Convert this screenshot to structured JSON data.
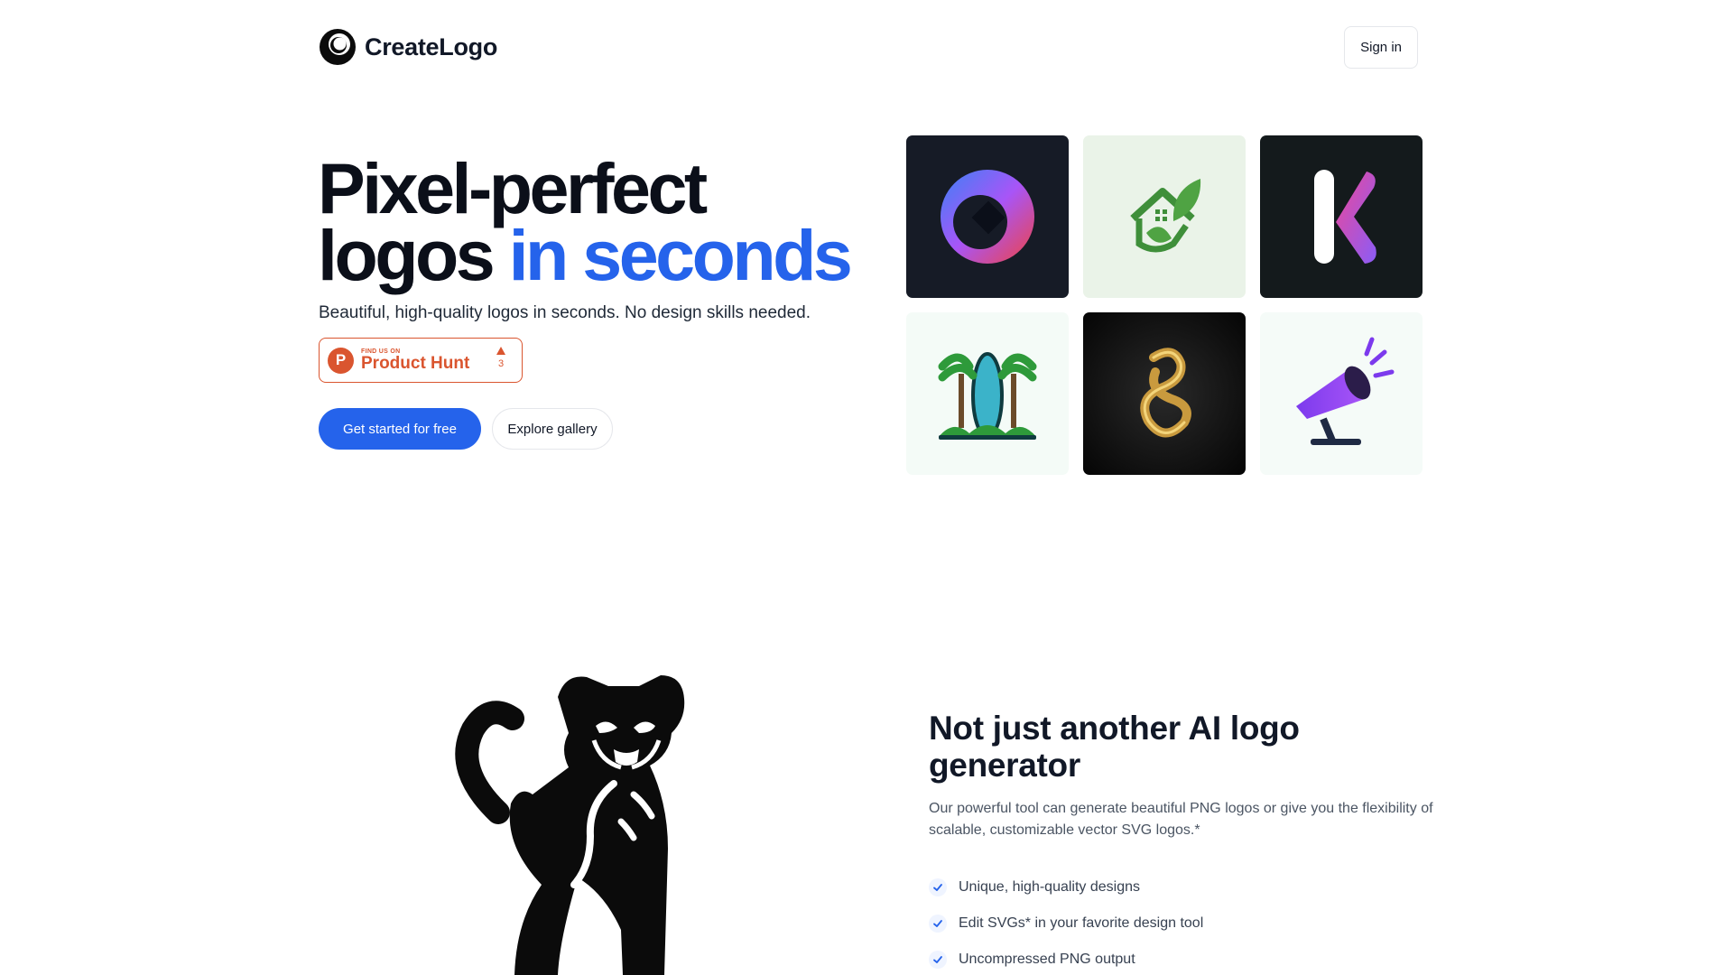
{
  "header": {
    "brand_name": "CreateLogo",
    "signin_label": "Sign in"
  },
  "hero": {
    "title_line1": "Pixel-perfect",
    "title_line2_plain": "logos ",
    "title_line2_accent": "in seconds",
    "subtitle": "Beautiful, high-quality logos in seconds. No design skills needed.",
    "product_hunt": {
      "small_text": "FIND US ON",
      "big_text": "Product Hunt",
      "vote_count": "3",
      "letter": "P"
    },
    "cta_primary": "Get started for free",
    "cta_secondary": "Explore gallery"
  },
  "gallery": {
    "tiles": [
      {
        "name": "orbit-logo"
      },
      {
        "name": "leaf-house-logo"
      },
      {
        "name": "letter-k-logo"
      },
      {
        "name": "palm-surfboard-logo"
      },
      {
        "name": "gold-snake-logo"
      },
      {
        "name": "megaphone-logo"
      }
    ]
  },
  "features": {
    "title": "Not just another AI logo generator",
    "description": "Our powerful tool can generate beautiful PNG logos or give you the flexibility of scalable, customizable vector SVG logos.*",
    "items": [
      "Unique, high-quality designs",
      "Edit SVGs* in your favorite design tool",
      "Uncompressed PNG output"
    ]
  },
  "colors": {
    "accent": "#2563eb",
    "product_hunt": "#da552f"
  }
}
